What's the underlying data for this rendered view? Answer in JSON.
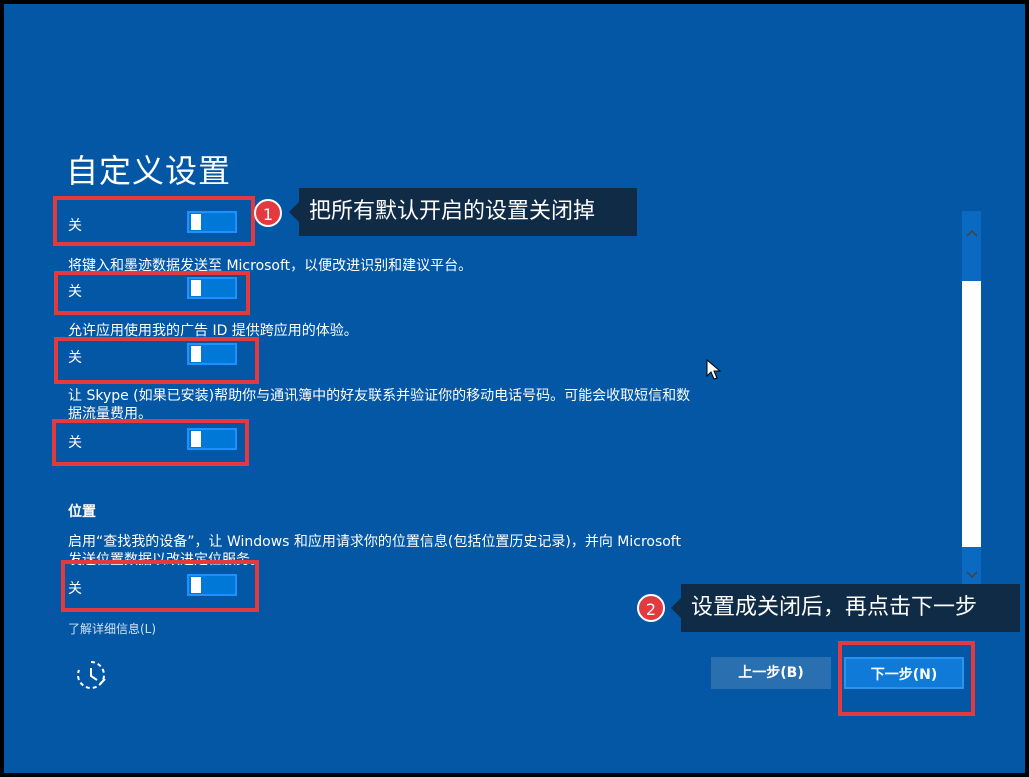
{
  "page": {
    "title": "自定义设置",
    "toggles": [
      {
        "state_label": "关",
        "on": false
      },
      {
        "state_label": "关",
        "on": false
      },
      {
        "state_label": "关",
        "on": false
      },
      {
        "state_label": "关",
        "on": false
      },
      {
        "state_label": "关",
        "on": false
      }
    ],
    "descriptions": [
      "将键入和墨迹数据发送至 Microsoft，以便改进识别和建议平台。",
      "允许应用使用我的广告 ID 提供跨应用的体验。",
      "让 Skype (如果已安装)帮助你与通讯簿中的好友联系并验证你的移动电话号码。可能会收取短信和数",
      "据流量费用。"
    ],
    "location": {
      "section_title": "位置",
      "description_line1": "启用“查找我的设备”，让 Windows 和应用请求你的位置信息(包括位置历史记录)，并向 Microsoft",
      "description_line2": "发送位置数据以改进定位服务。"
    },
    "learn_more_link": "了解详细信息(L)",
    "back_button": "上一步(B)",
    "next_button": "下一步(N)"
  },
  "annotations": {
    "callout1": {
      "number": "1",
      "text": "把所有默认开启的设置关闭掉"
    },
    "callout2": {
      "number": "2",
      "text": "设置成关闭后，再点击下一步"
    }
  },
  "colors": {
    "background": "#0457a5",
    "toggle_fill": "#0078d7",
    "highlight_red": "#e23a3e",
    "callout_bg": "#0f2b46"
  },
  "icons": {
    "ease_of_access": "ease-of-access-icon",
    "scroll_up": "chevron-up-icon",
    "scroll_down": "chevron-down-icon",
    "cursor": "mouse-pointer-icon"
  }
}
